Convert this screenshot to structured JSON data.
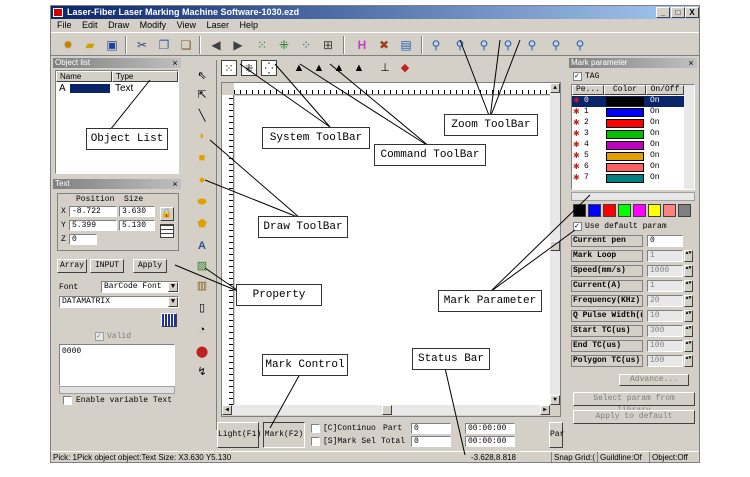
{
  "app": {
    "title": "Laser-Fiber Laser Marking Machine Software-1030.ezd",
    "window_buttons": [
      "_",
      "□",
      "X"
    ]
  },
  "menu": [
    "File",
    "Edit",
    "Draw",
    "Modify",
    "View",
    "Laser",
    "Help"
  ],
  "object_list": {
    "title": "Object list",
    "col_name": "Name",
    "col_type": "Type",
    "rows": [
      {
        "name": "A",
        "type": "Text"
      }
    ]
  },
  "text_panel": {
    "title": "Text",
    "position_label": "Position",
    "size_label": "Size",
    "x_label": "X",
    "y_label": "Y",
    "z_label": "Z",
    "x_pos": "-8.722",
    "x_size": "3.630",
    "y_pos": "5.399",
    "y_size": "5.130",
    "z_pos": "0",
    "array_btn": "Array",
    "input_btn": "INPUT",
    "apply_btn": "Apply",
    "font_label": "Font",
    "font_value": "BarCode Font",
    "barcode_value": "DATAMATRIX",
    "valid_label": "Valid",
    "text_value": "0000",
    "variable_label": "Enable variable Text"
  },
  "mark_param": {
    "title": "Mark parameter",
    "tag_label": "TAG",
    "headers": [
      "Pe...",
      "Color",
      "On/Off"
    ],
    "pens": [
      {
        "n": "0",
        "color": "#000000",
        "state": "On"
      },
      {
        "n": "1",
        "color": "#0000ff",
        "state": "On"
      },
      {
        "n": "2",
        "color": "#ff0000",
        "state": "On"
      },
      {
        "n": "3",
        "color": "#00c000",
        "state": "On"
      },
      {
        "n": "4",
        "color": "#c000c0",
        "state": "On"
      },
      {
        "n": "5",
        "color": "#e0a000",
        "state": "On"
      },
      {
        "n": "6",
        "color": "#ff6060",
        "state": "On"
      },
      {
        "n": "7",
        "color": "#008080",
        "state": "On"
      }
    ],
    "palette": [
      "#000000",
      "#0000ff",
      "#ff0000",
      "#00ff00",
      "#ff00ff",
      "#ffff00",
      "#ff8080",
      "#808080"
    ],
    "use_default_label": "Use default param",
    "params": [
      {
        "label": "Current pen",
        "value": "0"
      },
      {
        "label": "Mark Loop",
        "value": "1"
      },
      {
        "label": "Speed(mm/s)",
        "value": "1000"
      },
      {
        "label": "Current(A)",
        "value": "1"
      },
      {
        "label": "Frequency(KHz)",
        "value": "20"
      },
      {
        "label": "Q Pulse Width(u",
        "value": "10"
      },
      {
        "label": "Start TC(us)",
        "value": "300"
      },
      {
        "label": "End TC(us)",
        "value": "100"
      },
      {
        "label": "Polygon TC(us)",
        "value": "100"
      }
    ],
    "advance_btn": "Advance...",
    "library_btn": "Select param from library",
    "apply_default_btn": "Apply to default"
  },
  "bottom": {
    "light_btn": "Light(F1)",
    "mark_btn": "Mark(F2)",
    "continue_label": "[C]Continuo",
    "part_label": "Part",
    "part_value": "0",
    "sel_label": "[S]Mark Sel",
    "total_label": "Total",
    "total_value": "0",
    "time1": "00:00:00",
    "time2": "00:00:00",
    "para_label": "Par"
  },
  "status": {
    "left": "Pick: 1Pick object object:Text Size: X3.630 Y5.130",
    "coords": "-3.628,8.818",
    "snap": "Snap Grid:(",
    "guideline": "Guildline:Of",
    "object": "Object:Off"
  },
  "callouts": {
    "object_list": "Object List",
    "system_toolbar": "System ToolBar",
    "command_toolbar": "Command ToolBar",
    "zoom_toolbar": "Zoom ToolBar",
    "draw_toolbar": "Draw ToolBar",
    "property": "Property",
    "mark_parameter": "Mark Parameter",
    "mark_control": "Mark Control",
    "status_bar": "Status Bar"
  },
  "icons": {
    "toolbar": [
      "new-icon",
      "open-icon",
      "save-icon",
      "cut-icon",
      "copy-icon",
      "paste-icon",
      "undo-icon",
      "redo-icon",
      "grid-icon",
      "node-icon",
      "select-icon",
      "snap-icon",
      "hatch-icon",
      "tools-icon",
      "calc-icon",
      "zoom-icon",
      "zoom-in-icon",
      "zoom-out-icon",
      "zoom-fit-icon",
      "zoom-all-icon",
      "zoom-sel-icon",
      "zoom-page-icon"
    ]
  }
}
